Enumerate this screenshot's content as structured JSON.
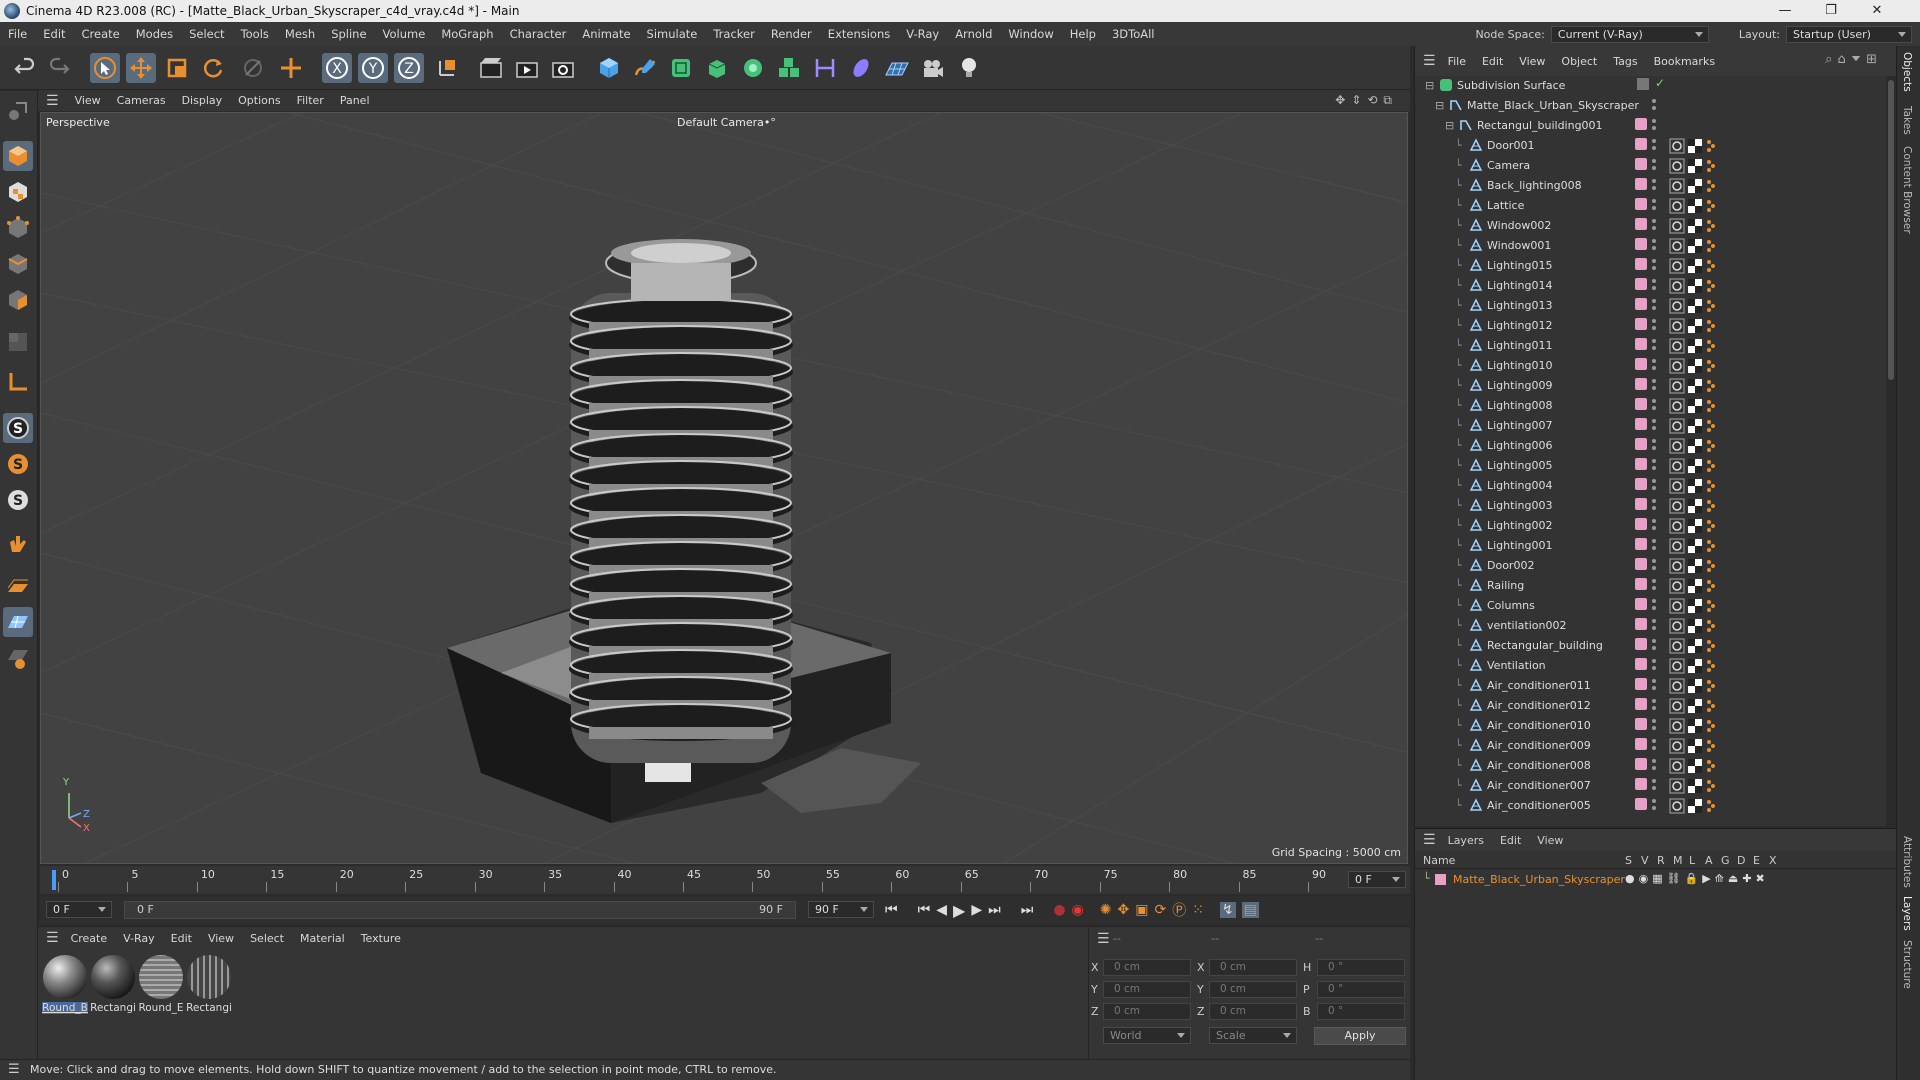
{
  "titlebar": {
    "title": "Cinema 4D R23.008 (RC) - [Matte_Black_Urban_Skyscraper_c4d_vray.c4d *] - Main",
    "min": "—",
    "max": "❐",
    "close": "✕"
  },
  "menubar": {
    "items": [
      "File",
      "Edit",
      "Create",
      "Modes",
      "Select",
      "Tools",
      "Mesh",
      "Spline",
      "Volume",
      "MoGraph",
      "Character",
      "Animate",
      "Simulate",
      "Tracker",
      "Render",
      "Extensions",
      "V-Ray",
      "Arnold",
      "Window",
      "Help",
      "3DToAll"
    ],
    "node_space_label": "Node Space:",
    "node_space_value": "Current (V-Ray)",
    "layout_label": "Layout:",
    "layout_value": "Startup (User)"
  },
  "viewport_menu": {
    "items": [
      "View",
      "Cameras",
      "Display",
      "Options",
      "Filter",
      "Panel"
    ]
  },
  "viewport": {
    "label": "Perspective",
    "camera": "Default Camera",
    "camera_icon": "•°",
    "grid_spacing": "Grid Spacing : 5000 cm",
    "axis_y": "Y",
    "axis_z": "Z",
    "axis_x": "X"
  },
  "timeline": {
    "ticks": [
      "0",
      "5",
      "10",
      "15",
      "20",
      "25",
      "30",
      "35",
      "40",
      "45",
      "50",
      "55",
      "60",
      "65",
      "70",
      "75",
      "80",
      "85",
      "90"
    ],
    "frame_field": "0 F",
    "start_field": "0 F",
    "range_start": "0 F",
    "range_end": "90 F",
    "end_field": "90 F"
  },
  "material_panel": {
    "menu": [
      "Create",
      "V-Ray",
      "Edit",
      "View",
      "Select",
      "Material",
      "Texture"
    ],
    "materials": [
      {
        "label": "Round_B",
        "selected": true
      },
      {
        "label": "Rectangi",
        "selected": false
      },
      {
        "label": "Round_E",
        "selected": false
      },
      {
        "label": "Rectangi",
        "selected": false
      }
    ]
  },
  "coord_panel": {
    "header": [
      "--",
      "--",
      "--"
    ],
    "rows": [
      {
        "l1": "X",
        "v1": "0 cm",
        "l2": "X",
        "v2": "0 cm",
        "l3": "H",
        "v3": "0 °"
      },
      {
        "l1": "Y",
        "v1": "0 cm",
        "l2": "Y",
        "v2": "0 cm",
        "l3": "P",
        "v3": "0 °"
      },
      {
        "l1": "Z",
        "v1": "0 cm",
        "l2": "Z",
        "v2": "0 cm",
        "l3": "B",
        "v3": "0 °"
      }
    ],
    "world": "World",
    "scale": "Scale",
    "apply": "Apply"
  },
  "status": {
    "text": "Move: Click and drag to move elements. Hold down SHIFT to quantize movement / add to the selection in point mode, CTRL to remove."
  },
  "object_panel": {
    "menu": [
      "File",
      "Edit",
      "View",
      "Object",
      "Tags",
      "Bookmarks"
    ],
    "root": "Subdivision Surface",
    "group": "Matte_Black_Urban_Skyscraper",
    "subgroup": "Rectangul_building001",
    "children": [
      "Door001",
      "Camera",
      "Back_lighting008",
      "Lattice",
      "Window002",
      "Window001",
      "Lighting015",
      "Lighting014",
      "Lighting013",
      "Lighting012",
      "Lighting011",
      "Lighting010",
      "Lighting009",
      "Lighting008",
      "Lighting007",
      "Lighting006",
      "Lighting005",
      "Lighting004",
      "Lighting003",
      "Lighting002",
      "Lighting001",
      "Door002",
      "Railing",
      "Columns",
      "ventilation002",
      "Rectangular_building",
      "Ventilation",
      "Air_conditioner011",
      "Air_conditioner012",
      "Air_conditioner010",
      "Air_conditioner009",
      "Air_conditioner008",
      "Air_conditioner007",
      "Air_conditioner005"
    ]
  },
  "layer_panel": {
    "menu": [
      "Layers",
      "Edit",
      "View"
    ],
    "name_col": "Name",
    "cols": [
      "S",
      "V",
      "R",
      "M",
      "L",
      "A",
      "G",
      "D",
      "E",
      "X"
    ],
    "layer": "Matte_Black_Urban_Skyscraper"
  },
  "right_tabs": [
    "Objects",
    "Takes",
    "Content Browser",
    "Attributes",
    "Layers",
    "Structure"
  ],
  "colors": {
    "accent": "#e8902f",
    "selection": "#5a6b7d",
    "layer_color": "#e9a0c6"
  }
}
